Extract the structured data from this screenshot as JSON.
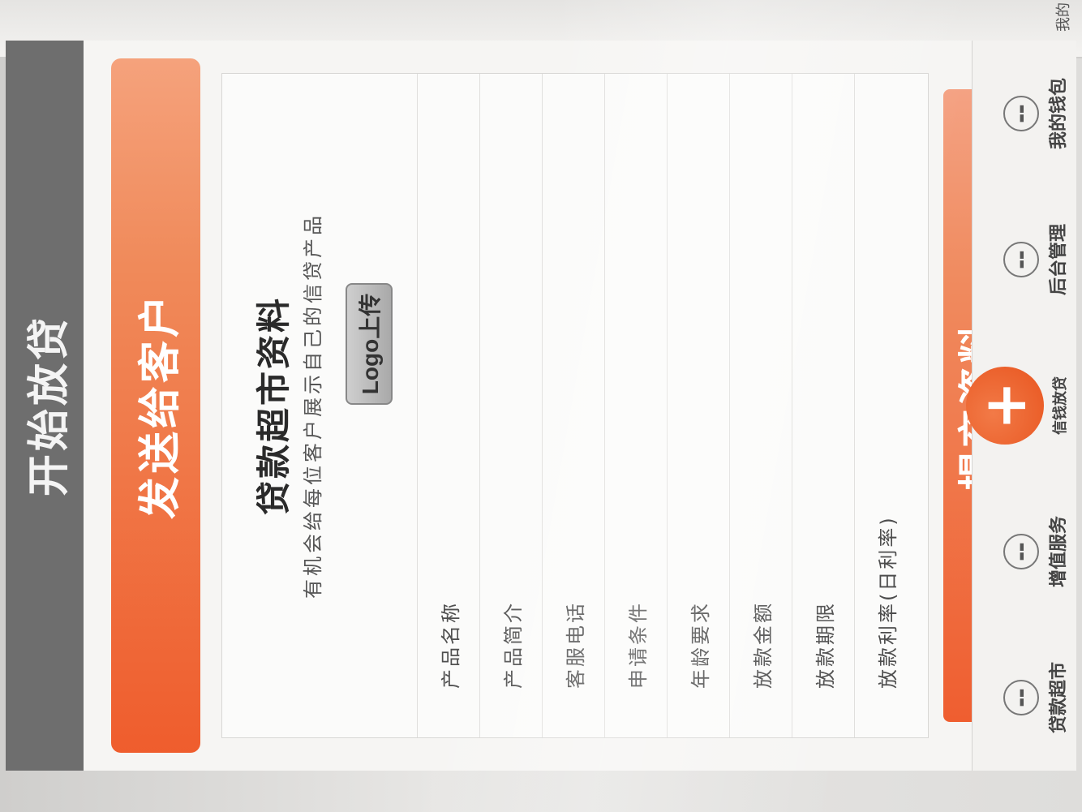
{
  "app": {
    "title": "开始放贷"
  },
  "send_button": {
    "label": "发送给客户"
  },
  "card": {
    "title": "贷款超市资料",
    "subtitle": "有机会给每位客户展示自己的信贷产品",
    "logo_upload_label": "Logo上传"
  },
  "fields": [
    {
      "label": "产品名称"
    },
    {
      "label": "产品简介"
    },
    {
      "label": "客服电话"
    },
    {
      "label": "申请条件"
    },
    {
      "label": "年龄要求"
    },
    {
      "label": "放款金额"
    },
    {
      "label": "放款期限"
    },
    {
      "label": "放款利率(日利率)"
    }
  ],
  "submit_button": {
    "label": "提交资料"
  },
  "tabbar": {
    "items": [
      {
        "label": "贷款超市",
        "icon": "circle-icon"
      },
      {
        "label": "增值服务",
        "icon": "circle-icon"
      },
      {
        "label": "信钱放贷",
        "icon": "plus-icon"
      },
      {
        "label": "后台管理",
        "icon": "circle-icon"
      },
      {
        "label": "我的钱包",
        "icon": "circle-icon"
      }
    ]
  },
  "next_screen": {
    "partial_label": "我的"
  },
  "colors": {
    "accent": "#ef5d2d",
    "topbar": "#6e6e6e"
  }
}
